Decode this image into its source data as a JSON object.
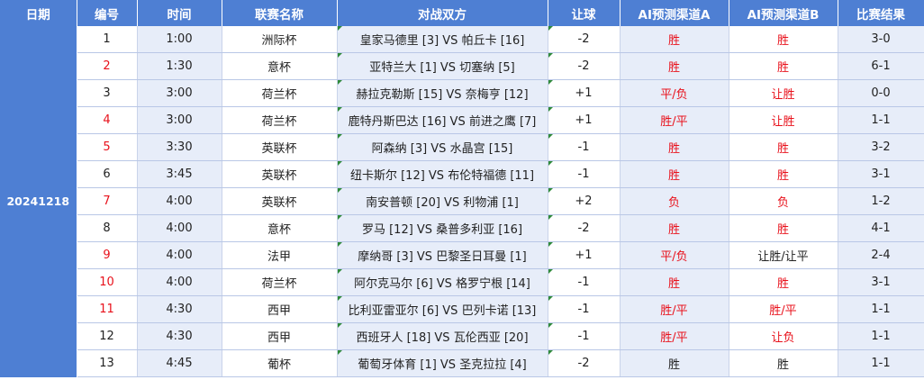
{
  "headers": [
    "日期",
    "编号",
    "时间",
    "联赛名称",
    "对战双方",
    "让球",
    "AI预测渠道A",
    "AI预测渠道B",
    "比赛结果"
  ],
  "date": "20241218",
  "colors": {
    "header_bg": "#4e7fd3",
    "shade": "#e7edf9",
    "red": "#e8111b",
    "marker": "#2f8a3a"
  },
  "rows": [
    {
      "num": "1",
      "time": "1:00",
      "league": "洲际杯",
      "match": "皇家马德里 [3] VS 帕丘卡 [16]",
      "handicap": "-2",
      "a": "胜",
      "b": "胜",
      "result": "3-0",
      "num_red": false,
      "a_red": true,
      "b_red": true
    },
    {
      "num": "2",
      "time": "1:30",
      "league": "意杯",
      "match": "亚特兰大 [1] VS 切塞纳 [5]",
      "handicap": "-2",
      "a": "胜",
      "b": "胜",
      "result": "6-1",
      "num_red": true,
      "a_red": true,
      "b_red": true
    },
    {
      "num": "3",
      "time": "3:00",
      "league": "荷兰杯",
      "match": "赫拉克勒斯 [15] VS 奈梅亨 [12]",
      "handicap": "+1",
      "a": "平/负",
      "b": "让胜",
      "result": "0-0",
      "num_red": false,
      "a_red": true,
      "b_red": true
    },
    {
      "num": "4",
      "time": "3:00",
      "league": "荷兰杯",
      "match": "鹿特丹斯巴达 [16] VS 前进之鹰 [7]",
      "handicap": "+1",
      "a": "胜/平",
      "b": "让胜",
      "result": "1-1",
      "num_red": true,
      "a_red": true,
      "b_red": true
    },
    {
      "num": "5",
      "time": "3:30",
      "league": "英联杯",
      "match": "阿森纳 [3] VS 水晶宫 [15]",
      "handicap": "-1",
      "a": "胜",
      "b": "胜",
      "result": "3-2",
      "num_red": true,
      "a_red": true,
      "b_red": true
    },
    {
      "num": "6",
      "time": "3:45",
      "league": "英联杯",
      "match": "纽卡斯尔 [12] VS 布伦特福德 [11]",
      "handicap": "-1",
      "a": "胜",
      "b": "胜",
      "result": "3-1",
      "num_red": false,
      "a_red": true,
      "b_red": true
    },
    {
      "num": "7",
      "time": "4:00",
      "league": "英联杯",
      "match": "南安普顿 [20] VS 利物浦 [1]",
      "handicap": "+2",
      "a": "负",
      "b": "负",
      "result": "1-2",
      "num_red": true,
      "a_red": true,
      "b_red": true
    },
    {
      "num": "8",
      "time": "4:00",
      "league": "意杯",
      "match": "罗马 [12] VS 桑普多利亚 [16]",
      "handicap": "-2",
      "a": "胜",
      "b": "胜",
      "result": "4-1",
      "num_red": false,
      "a_red": true,
      "b_red": true
    },
    {
      "num": "9",
      "time": "4:00",
      "league": "法甲",
      "match": "摩纳哥 [3] VS 巴黎圣日耳曼 [1]",
      "handicap": "+1",
      "a": "平/负",
      "b": "让胜/让平",
      "result": "2-4",
      "num_red": true,
      "a_red": true,
      "b_red": false
    },
    {
      "num": "10",
      "time": "4:00",
      "league": "荷兰杯",
      "match": "阿尔克马尔 [6] VS 格罗宁根 [14]",
      "handicap": "-1",
      "a": "胜",
      "b": "胜",
      "result": "3-1",
      "num_red": true,
      "a_red": true,
      "b_red": true
    },
    {
      "num": "11",
      "time": "4:30",
      "league": "西甲",
      "match": "比利亚雷亚尔 [6] VS 巴列卡诺 [13]",
      "handicap": "-1",
      "a": "胜/平",
      "b": "胜/平",
      "result": "1-1",
      "num_red": true,
      "a_red": true,
      "b_red": true
    },
    {
      "num": "12",
      "time": "4:30",
      "league": "西甲",
      "match": "西班牙人 [18] VS 瓦伦西亚 [20]",
      "handicap": "-1",
      "a": "胜/平",
      "b": "让负",
      "result": "1-1",
      "num_red": false,
      "a_red": true,
      "b_red": true
    },
    {
      "num": "13",
      "time": "4:45",
      "league": "葡杯",
      "match": "葡萄牙体育 [1] VS 圣克拉拉 [4]",
      "handicap": "-2",
      "a": "胜",
      "b": "胜",
      "result": "1-1",
      "num_red": false,
      "a_red": false,
      "b_red": false
    }
  ]
}
